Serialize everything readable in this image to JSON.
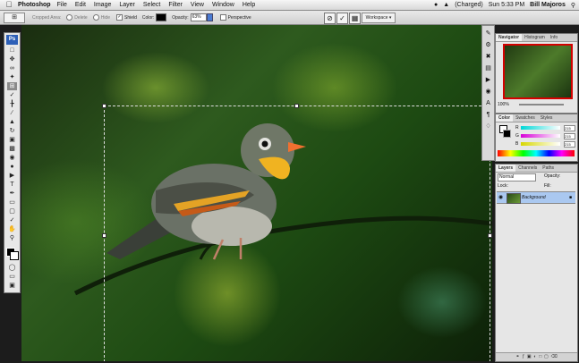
{
  "menubar": {
    "app": "Photoshop",
    "menus": [
      "File",
      "Edit",
      "Image",
      "Layer",
      "Select",
      "Filter",
      "View",
      "Window",
      "Help"
    ],
    "battery": "(Charged)",
    "clock": "Sun 5:33 PM",
    "user": "Bill Majoros"
  },
  "options": {
    "cropped_area": "Cropped Area:",
    "delete": "Delete",
    "hide": "Hide",
    "shield": "Shield",
    "color": "Color:",
    "opacity_label": "Opacity:",
    "opacity_value": "63%",
    "perspective": "Perspective",
    "workspace": "Workspace"
  },
  "navigator": {
    "tabs": [
      "Navigator",
      "Histogram",
      "Info"
    ],
    "zoom": "100%"
  },
  "colorpanel": {
    "tabs": [
      "Color",
      "Swatches",
      "Styles"
    ],
    "r": "215",
    "g": "215",
    "b": "215",
    "r_label": "R",
    "g_label": "G",
    "b_label": "B"
  },
  "layers": {
    "tabs": [
      "Layers",
      "Channels",
      "Paths"
    ],
    "mode": "Normal",
    "opacity": "Opacity:",
    "lock": "Lock:",
    "fill": "Fill:",
    "layer_name": "Background"
  },
  "toolbox": {
    "logo": "Ps"
  }
}
